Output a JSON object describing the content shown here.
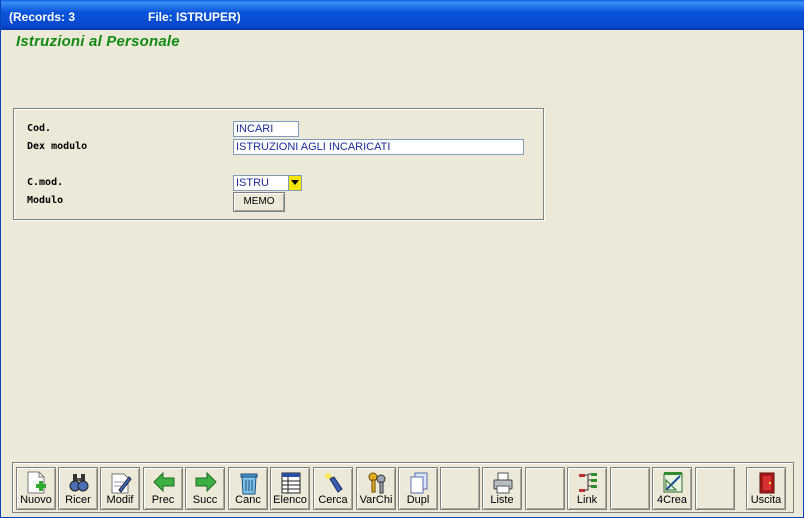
{
  "window": {
    "title_records": "(Records: 3",
    "title_file": "File: ISTRUPER)"
  },
  "form": {
    "title": "Istruzioni al Personale",
    "fields": {
      "cod_label": "Cod.",
      "cod_value": "INCARI",
      "dex_label": "Dex modulo",
      "dex_value": "ISTRUZIONI AGLI INCARICATI",
      "cmod_label": "C.mod.",
      "cmod_value": "ISTRU",
      "modulo_label": "Modulo",
      "memo_button": "MEMO"
    }
  },
  "toolbar": {
    "nuovo": "Nuovo",
    "ricer": "Ricer",
    "modif": "Modif",
    "prec": "Prec",
    "succ": "Succ",
    "canc": "Canc",
    "elenco": "Elenco",
    "cerca": "Cerca",
    "varchi": "VarChi",
    "dupl": "Dupl",
    "liste": "Liste",
    "link": "Link",
    "crea": "4Crea",
    "uscita": "Uscita"
  },
  "colors": {
    "title_bar": "#0b55db",
    "form_title": "#118a11",
    "field_text": "#1a2b9a",
    "combo_button": "#f5e400",
    "background": "#ece9d8"
  }
}
